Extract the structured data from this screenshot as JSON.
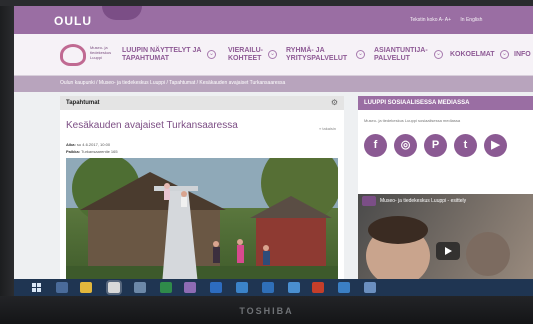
{
  "brand_text": "TOSHIBA",
  "site": {
    "logo_text": "OULU",
    "toplinks": [
      "Tekstin koko A- A+",
      "In English"
    ]
  },
  "nav": {
    "logo_label": "Museo- ja tiedekeskus Luuppi",
    "items": [
      {
        "line1": "LUUPIN NÄYTTELYT JA",
        "line2": "TAPAHTUMAT"
      },
      {
        "line1": "VIERAILU-",
        "line2": "KOHTEET"
      },
      {
        "line1": "RYHMÄ- JA",
        "line2": "YRITYSPALVELUT"
      },
      {
        "line1": "ASIANTUNTIJA-",
        "line2": "PALVELUT"
      },
      {
        "line1": "KOKOELMAT",
        "line2": ""
      },
      {
        "line1": "INFO",
        "line2": ""
      }
    ]
  },
  "breadcrumb": "Oulun kaupunki / Museo- ja tiedekeskus Luuppi / Tapahtumat / Kesäkauden avajaiset Turkansaaressa",
  "main": {
    "section_title": "Tapahtumat",
    "gear": "⚙",
    "article_title": "Kesäkauden avajaiset Turkansaaressa",
    "back_link": "« takaisin",
    "aika_label": "Aika:",
    "aika_value": "su 4.6.2017, 10:00",
    "paikka_label": "Paikka:",
    "paikka_value": "Turkansaarentie 165"
  },
  "sidebar": {
    "title": "LUUPPI SOSIAALISESSA MEDIASSA",
    "intro": "Museo- ja tiedekeskus Luuppi sosiaalisessa mediassa",
    "social_icons": [
      "facebook-icon",
      "instagram-icon",
      "pinterest-icon",
      "twitter-icon",
      "youtube-icon"
    ],
    "social_glyphs": [
      "f",
      "◎",
      "P",
      "t",
      "▶"
    ],
    "video_title": "Museo- ja tiedekeskus Luuppi - esittely"
  },
  "colors": {
    "accent": "#9a6ea3",
    "accent_dark": "#7b4e86",
    "taskbar": "#1f3552"
  }
}
